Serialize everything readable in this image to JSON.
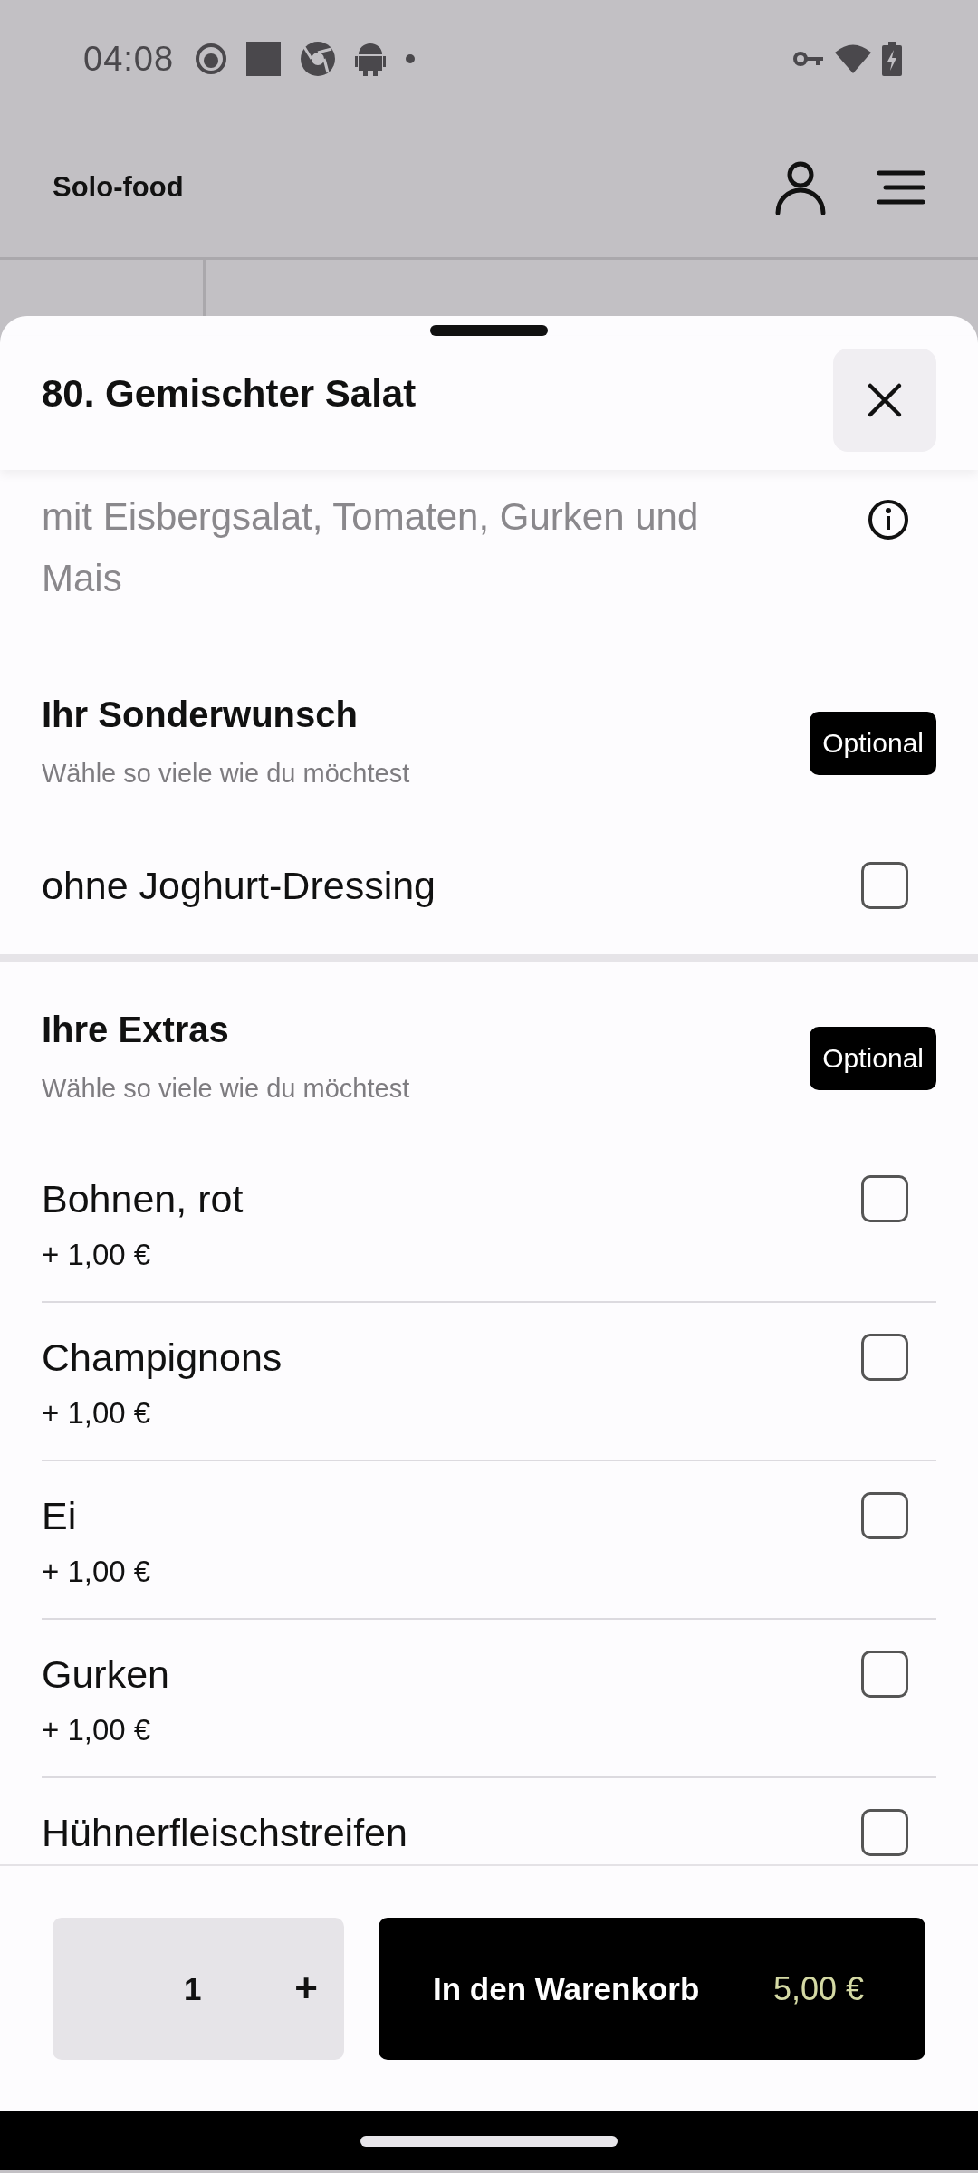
{
  "status_bar": {
    "time": "04:08"
  },
  "header": {
    "title": "Solo-food"
  },
  "sheet": {
    "title": "80. Gemischter Salat",
    "description": "mit Eisbergsalat, Tomaten, Gurken und Mais",
    "sections": [
      {
        "title": "Ihr Sonderwunsch",
        "subtitle": "Wähle so viele wie du möchtest",
        "badge": "Optional",
        "options": [
          {
            "label": "ohne Joghurt-Dressing",
            "checked": false
          }
        ]
      },
      {
        "title": "Ihre Extras",
        "subtitle": "Wähle so viele wie du möchtest",
        "badge": "Optional",
        "options": [
          {
            "label": "Bohnen, rot",
            "price": "+ 1,00 €",
            "checked": false
          },
          {
            "label": "Champignons",
            "price": "+ 1,00 €",
            "checked": false
          },
          {
            "label": "Ei",
            "price": "+ 1,00 €",
            "checked": false
          },
          {
            "label": "Gurken",
            "price": "+ 1,00 €",
            "checked": false
          },
          {
            "label": "Hühnerfleischstreifen",
            "checked": false
          }
        ]
      }
    ]
  },
  "footer": {
    "quantity": "1",
    "increment": "+",
    "cart_button": "In den Warenkorb",
    "price": "5,00 €"
  }
}
